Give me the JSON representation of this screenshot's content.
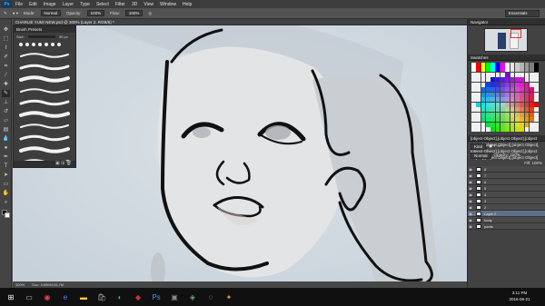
{
  "app": {
    "logo": "Ps",
    "menus": [
      "File",
      "Edit",
      "Image",
      "Layer",
      "Type",
      "Select",
      "Filter",
      "3D",
      "View",
      "Window",
      "Help"
    ]
  },
  "options": {
    "mode_label": "Mode:",
    "mode_value": "Normal",
    "opacity_label": "Opacity:",
    "opacity_value": "100%",
    "flow_label": "Flow:",
    "flow_value": "100%",
    "workspace": "Essentials"
  },
  "document": {
    "tab": "CHARLIE YUM! NEW.psd @ 300% (Layer 2, RGB/8) *",
    "zoom": "300%",
    "doc_size": "Doc: 3.65M/126.7M"
  },
  "brush_panel": {
    "title": "Brush Presets",
    "size_label": "Size:",
    "size_value": "30 px"
  },
  "right": {
    "navigator": "Navigator",
    "swatches": "Swatches",
    "layers": [
      {
        "name": "8"
      },
      {
        "name": "7"
      },
      {
        "name": "6"
      },
      {
        "name": "5"
      },
      {
        "name": "4"
      },
      {
        "name": "3"
      },
      {
        "name": "2"
      },
      {
        "name": "Layer 2",
        "selected": true
      },
      {
        "name": "body"
      },
      {
        "name": "pants"
      }
    ],
    "kind_label": "Kind",
    "blend": "Normal",
    "opacity": "Opacity: 100%",
    "fill": "Fill: 100%",
    "swatch_colors": [
      "#ffffff",
      "#ff0000",
      "#ffff00",
      "#00ff00",
      "#00ffff",
      "#0000ff",
      "#ff00ff",
      "#ffffff",
      "#e6e6e6",
      "#cccccc",
      "#b3b3b3",
      "#999999",
      "#808080",
      "#000000"
    ]
  },
  "taskbar": {
    "time": "3:11 PM",
    "date": "2016-06-21"
  }
}
